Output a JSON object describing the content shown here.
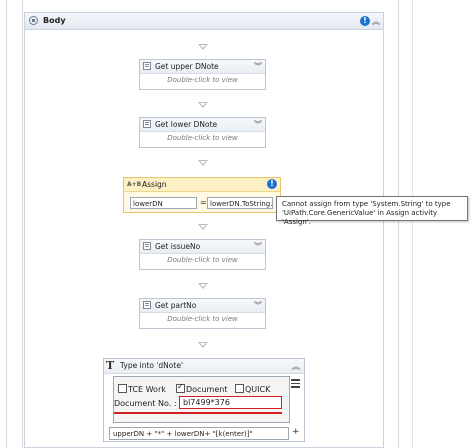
{
  "body": {
    "title": "Body"
  },
  "activities": [
    {
      "title": "Get upper DNote",
      "hint": "Double-click to view"
    },
    {
      "title": "Get lower DNote",
      "hint": "Double-click to view"
    },
    {
      "title": "Get issueNo",
      "hint": "Double-click to view"
    },
    {
      "title": "Get partNo",
      "hint": "Double-click to view"
    }
  ],
  "assign": {
    "icon_text": "A+B",
    "title": "Assign",
    "to_value": "lowerDN",
    "equals": "=",
    "expression": "lowerDN.ToString.",
    "error_icon": "!"
  },
  "tooltip": {
    "line1": "Cannot assign from type 'System.String' to type",
    "line2": "'UiPath.Core.GenericValue' in Assign activity 'Assign'."
  },
  "type_into": {
    "icon_text": "T",
    "title": "Type into 'dNote'",
    "checkbox_tce": "TCE Work",
    "checkbox_document": "Document",
    "checkbox_quick": "QUICK",
    "doc_label": "Document No. :",
    "doc_value": "bl7499*376",
    "text_expression": "upperDN + \"*\" + lowerDN+ \"[k(enter)]\"",
    "plus": "+"
  },
  "colors": {
    "error_blue": "#1a6fd0",
    "assign_bg": "#fff9e2",
    "highlight_red": "#d21f1f"
  },
  "icons": [
    "sequence-icon",
    "info-icon",
    "collapse-chevrons-icon",
    "expand-chevrons-icon",
    "menu-icon",
    "plus-icon"
  ]
}
